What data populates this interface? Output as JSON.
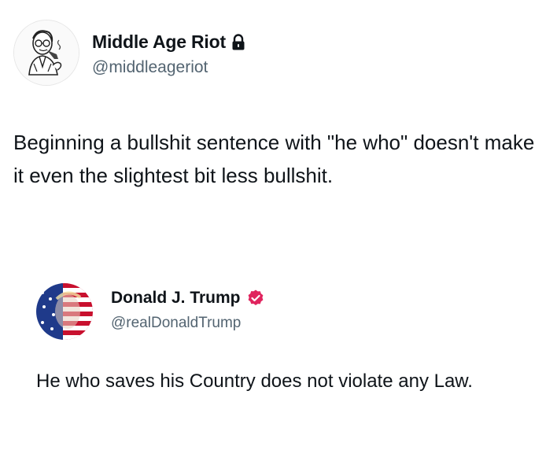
{
  "tweet": {
    "author": {
      "name": "Middle Age Riot",
      "handle": "@middleageriot",
      "avatar_icon": "cartoon-man-with-pipe",
      "badge_icon": "lock-icon"
    },
    "text": "Beginning a bullshit sentence with \"he who\" doesn't make it even the slightest bit less bullshit."
  },
  "quoted_tweet": {
    "author": {
      "name": "Donald J. Trump",
      "handle": "@realDonaldTrump",
      "avatar_icon": "flag-face-portrait",
      "badge_icon": "verified-badge-icon",
      "badge_color": "#e0245e"
    },
    "text": "He who saves his Country does not violate any Law."
  }
}
